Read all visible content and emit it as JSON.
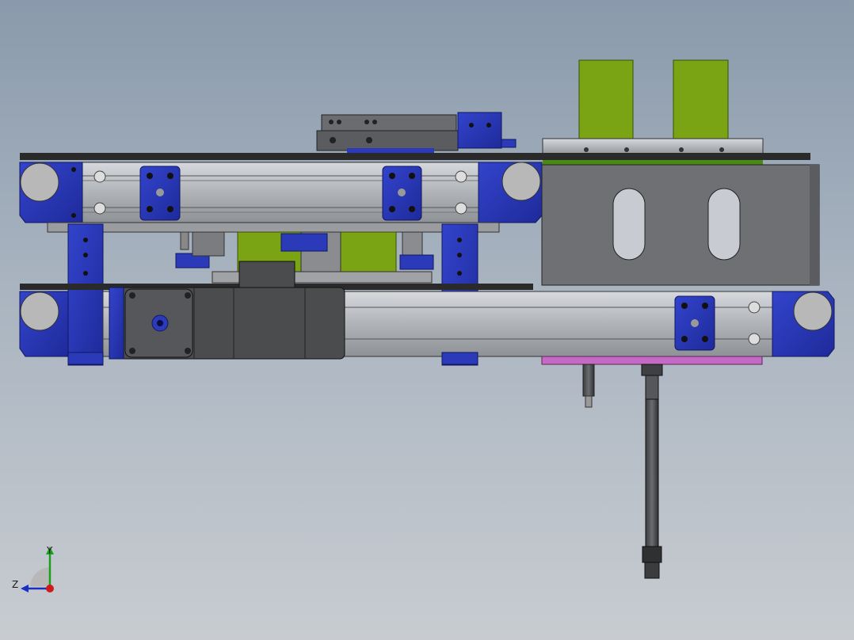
{
  "triad": {
    "y_label": "Y",
    "z_label": "Z"
  },
  "colors": {
    "bracket_blue": "#2a3ab8",
    "plate_dark": "#3c3c3c",
    "rail_grey": "#b4b6ba",
    "green_block": "#7aa414",
    "magenta_plate": "#c46ac4",
    "motor_grey": "#4a4c4e",
    "housing_grey": "#6e7074"
  },
  "icons": [
    "coordinate-triad-icon"
  ]
}
